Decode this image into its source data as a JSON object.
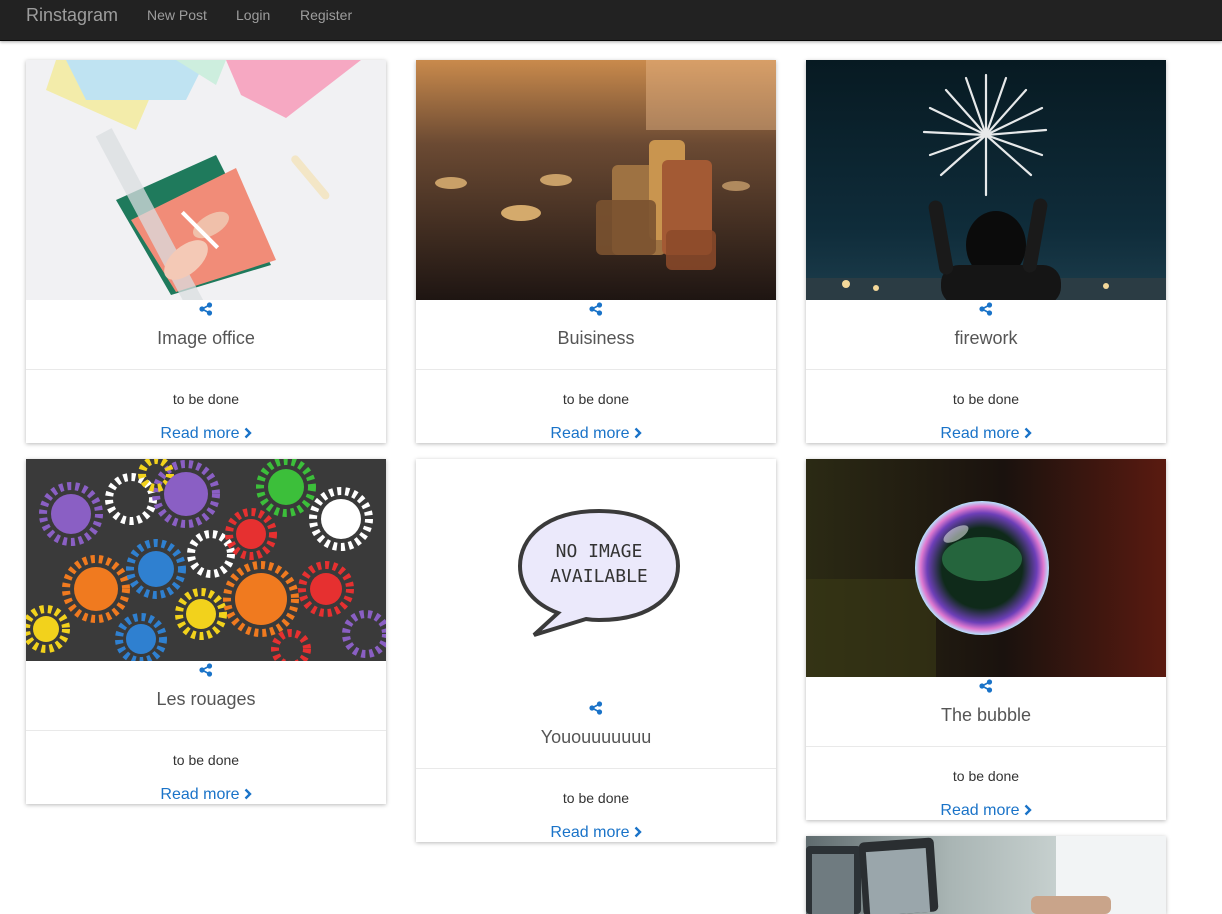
{
  "nav": {
    "brand": "Rinstagram",
    "links": [
      "New Post",
      "Login",
      "Register"
    ]
  },
  "colors": {
    "link": "#1a73c8",
    "navbar": "#222222"
  },
  "cards": [
    {
      "title": "Image office",
      "text": "to be done",
      "read_more": "Read more",
      "image": "office-desk-photo"
    },
    {
      "title": "Buisiness",
      "text": "to be done",
      "read_more": "Read more",
      "image": "coins-photo"
    },
    {
      "title": "firework",
      "text": "to be done",
      "read_more": "Read more",
      "image": "firework-photo"
    },
    {
      "title": "Les rouages",
      "text": "to be done",
      "read_more": "Read more",
      "image": "gears-photo"
    },
    {
      "title": "Yououuuuuuu",
      "text": "to be done",
      "read_more": "Read more",
      "image": "no-image-placeholder"
    },
    {
      "title": "The bubble",
      "text": "to be done",
      "read_more": "Read more",
      "image": "bubble-photo"
    },
    {
      "image": "laptop-photo"
    }
  ],
  "placeholder": {
    "line1": "NO IMAGE",
    "line2": "AVAILABLE"
  }
}
